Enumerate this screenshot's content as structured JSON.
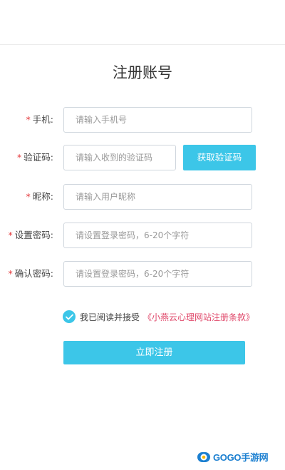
{
  "page": {
    "title": "注册账号"
  },
  "form": {
    "required_mark": "*",
    "fields": [
      {
        "label": "手机:",
        "placeholder": "请输入手机号"
      },
      {
        "label": "验证码:",
        "placeholder": "请输入收到的验证码"
      },
      {
        "label": "昵称:",
        "placeholder": "请输入用户昵称"
      },
      {
        "label": "设置密码:",
        "placeholder": "请设置登录密码，6-20个字符"
      },
      {
        "label": "确认密码:",
        "placeholder": "请设置登录密码，6-20个字符"
      }
    ],
    "get_code_button": "获取验证码",
    "agreement": {
      "text": "我已阅读并接受",
      "link": "《小燕云心理网站注册条款》",
      "checked": true
    },
    "submit_button": "立即注册"
  },
  "watermark": {
    "text": "GOGO手游网",
    "colors": {
      "primary": "#1b7fd0",
      "accent": "#f7b500"
    }
  },
  "colors": {
    "accent": "#3cc6e8",
    "required": "#e4393c",
    "link": "#e0496b"
  }
}
